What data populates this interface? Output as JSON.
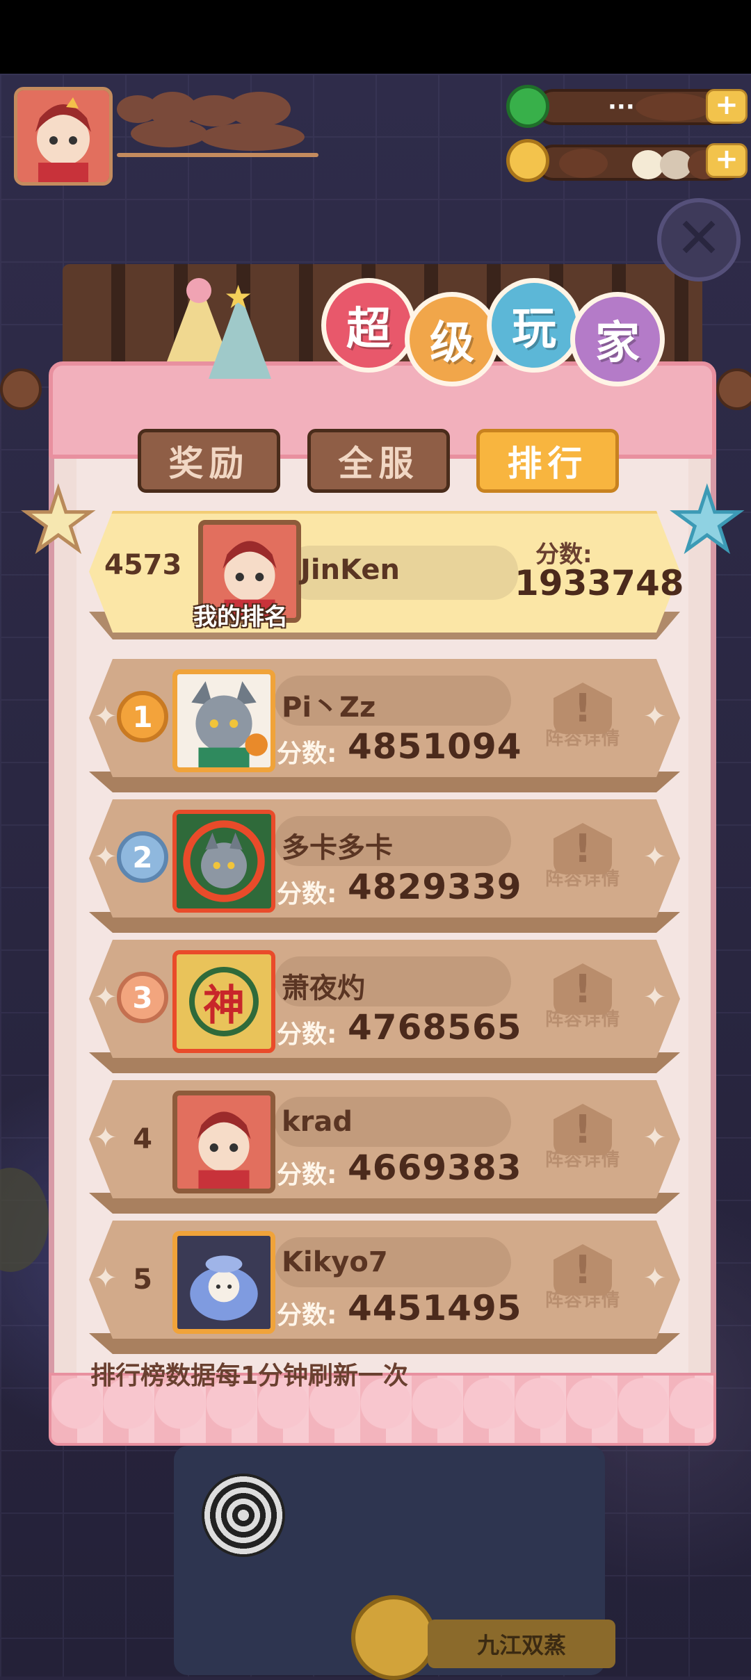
{
  "header": {
    "player_name_redacted": "",
    "resources": [
      {
        "icon": "green-gem-icon",
        "value_redacted": "·····"
      },
      {
        "icon": "gold-coin-icon",
        "value_redacted": ""
      }
    ],
    "plus_label": "+"
  },
  "title": {
    "chars": [
      "超",
      "级",
      "玩",
      "家"
    ],
    "colors": [
      "#e8586b",
      "#f1a64a",
      "#5cb7d7",
      "#b47bc8"
    ]
  },
  "tabs": [
    {
      "label": "奖励",
      "active": false
    },
    {
      "label": "全服",
      "active": false
    },
    {
      "label": "排行",
      "active": true
    }
  ],
  "my_rank": {
    "rank": "4573",
    "name": "JinKen",
    "score_label": "分数:",
    "score": "1933748",
    "badge": "我的排名"
  },
  "leaderboard": [
    {
      "rank": "1",
      "name": "Pi丶Zz",
      "score_label": "分数:",
      "score": "4851094",
      "detail_label": "阵容详情"
    },
    {
      "rank": "2",
      "name": "多卡多卡",
      "score_label": "分数:",
      "score": "4829339",
      "detail_label": "阵容详情"
    },
    {
      "rank": "3",
      "name": "萧夜灼",
      "score_label": "分数:",
      "score": "4768565",
      "detail_label": "阵容详情",
      "avatar_char": "神"
    },
    {
      "rank": "4",
      "name": "krad",
      "score_label": "分数:",
      "score": "4669383",
      "detail_label": "阵容详情"
    },
    {
      "rank": "5",
      "name": "Kikyo7",
      "score_label": "分数:",
      "score": "4451495",
      "detail_label": "阵容详情"
    }
  ],
  "footer_note": "排行榜数据每1分钟刷新一次",
  "background": {
    "shop_sign": "九江双蒸"
  }
}
